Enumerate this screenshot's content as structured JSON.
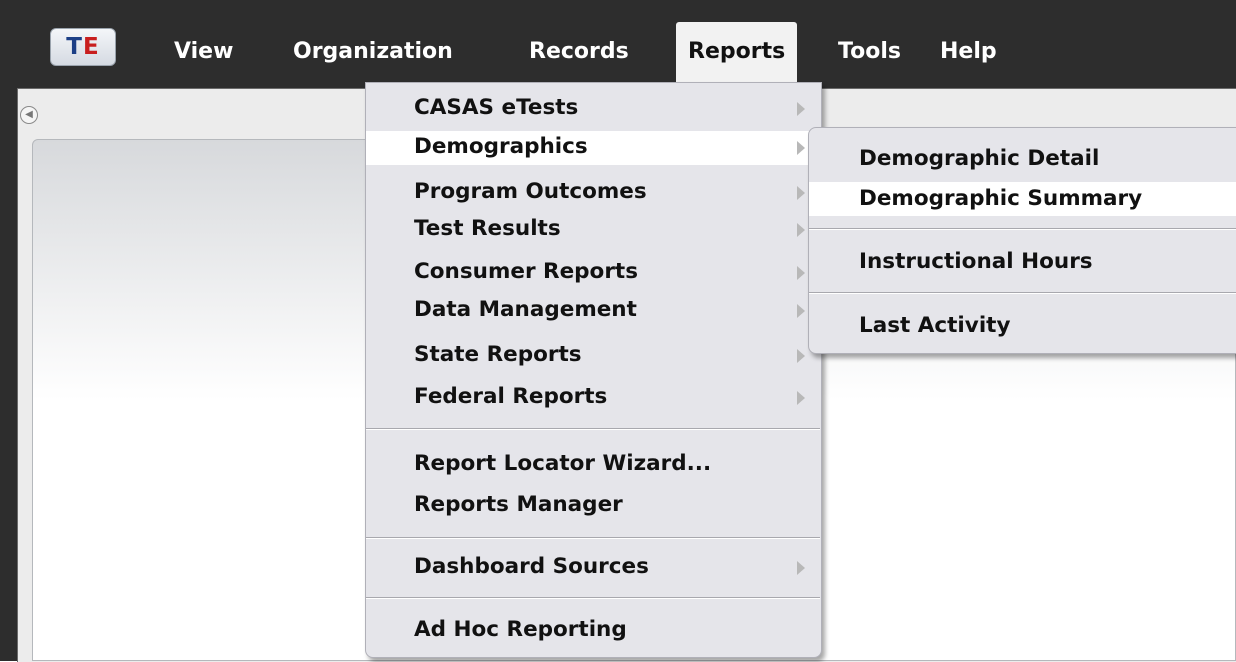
{
  "menubar": {
    "logo": {
      "t": "T",
      "e": "E"
    },
    "items": [
      "View",
      "Organization",
      "Records",
      "Reports",
      "Tools",
      "Help"
    ],
    "active": "Reports"
  },
  "reports_menu": {
    "items": [
      "CASAS eTests",
      "Demographics",
      "Program Outcomes",
      "Test Results",
      "Consumer Reports",
      "Data Management",
      "State Reports",
      "Federal Reports",
      "Report Locator Wizard...",
      "Reports Manager",
      "Dashboard Sources",
      "Ad Hoc Reporting"
    ],
    "highlighted": "Demographics"
  },
  "demographics_submenu": {
    "items": [
      "Demographic Detail",
      "Demographic Summary",
      "Instructional Hours",
      "Last Activity"
    ],
    "highlighted": "Demographic Summary"
  },
  "icons": {
    "collapse": "chevron-left-icon",
    "submenu_arrow": "triangle-right-icon"
  },
  "colors": {
    "menubar_bg": "#2d2d2d",
    "menu_bg": "#e5e5ea",
    "logo_t": "#1c3f86",
    "logo_e": "#c81e1e"
  }
}
